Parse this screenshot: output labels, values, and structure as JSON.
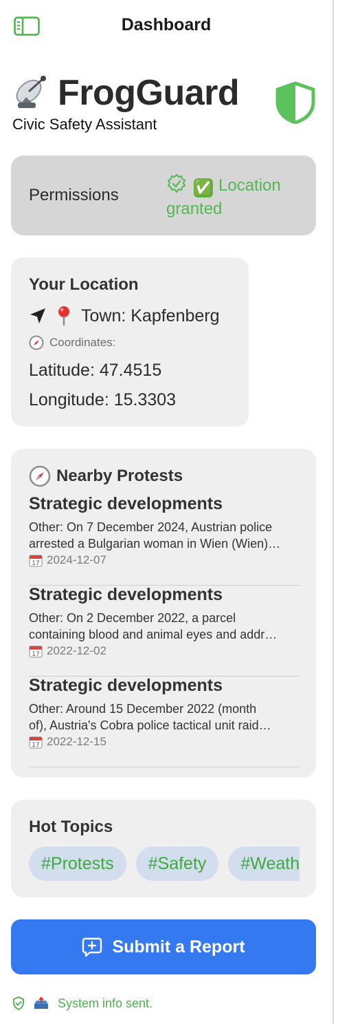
{
  "topbar": {
    "title": "Dashboard"
  },
  "hero": {
    "app_name": "FrogGuard",
    "subtitle": "Civic Safety Assistant"
  },
  "permissions": {
    "label": "Permissions",
    "status": "Location granted",
    "status_emoji": "✅"
  },
  "location": {
    "heading": "Your Location",
    "town": "Town: Kapfenberg",
    "coordinates_label": "Coordinates:",
    "latitude": "Latitude: 47.4515",
    "longitude": "Longitude: 15.3303"
  },
  "protests": {
    "heading": "Nearby Protests",
    "items": [
      {
        "title": "Strategic developments",
        "desc_line1": "Other: On 7 December 2024, Austrian police",
        "desc_line2": "arrested a Bulgarian woman in Wien (Wien)…",
        "date": "2024-12-07"
      },
      {
        "title": "Strategic developments",
        "desc_line1": "Other: On 2 December 2022, a parcel",
        "desc_line2": "containing blood and animal eyes and addr…",
        "date": "2022-12-02"
      },
      {
        "title": "Strategic developments",
        "desc_line1": "Other: Around 15 December 2022 (month",
        "desc_line2": "of), Austria's Cobra police tactical unit raid…",
        "date": "2022-12-15"
      }
    ]
  },
  "topics": {
    "heading": "Hot Topics",
    "chips": [
      "#Protests",
      "#Safety",
      "#Weather"
    ]
  },
  "submit": {
    "label": "Submit a Report"
  },
  "footer": {
    "status": "System info sent."
  },
  "colors": {
    "accent": "#3479f0",
    "success": "#52b852",
    "chip_bg": "#d2deee",
    "card_bg": "#efefef"
  }
}
